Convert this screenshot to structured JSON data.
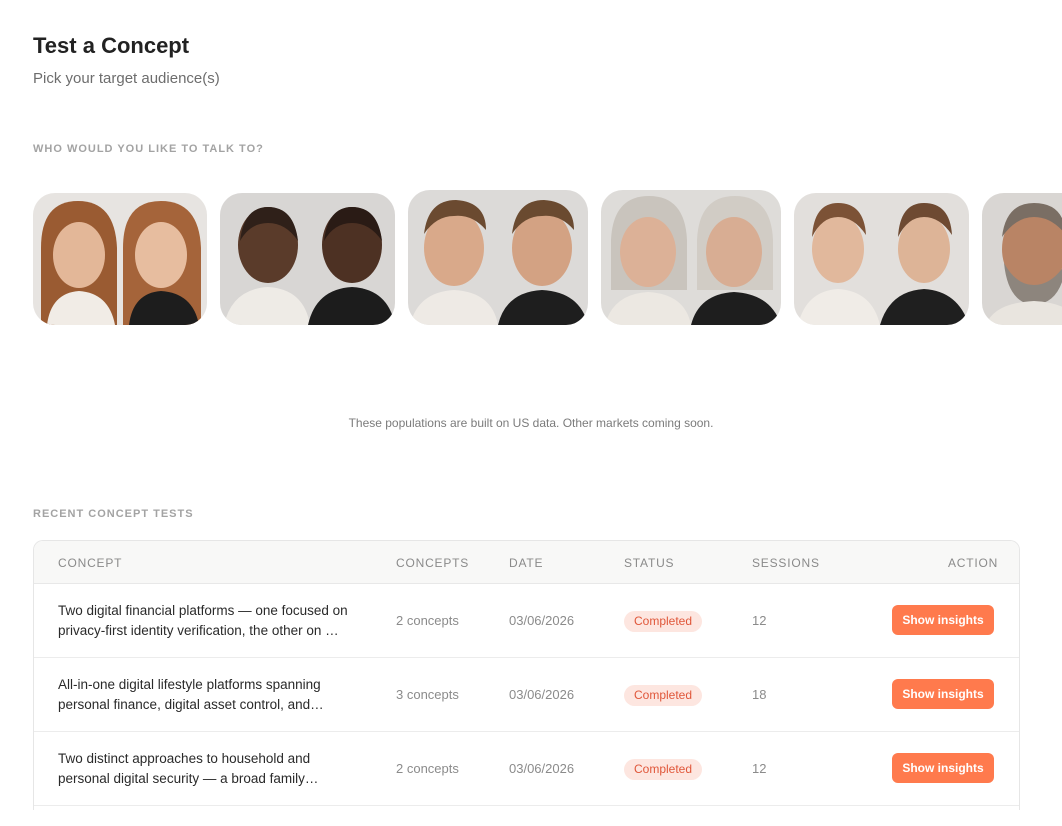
{
  "header": {
    "title": "Test a Concept",
    "subtitle": "Pick your target audience(s)"
  },
  "audience": {
    "section_label": "WHO WOULD YOU LIKE TO TALK TO?",
    "cards": [
      {
        "name": "young-women"
      },
      {
        "name": "older-black-men"
      },
      {
        "name": "young-men"
      },
      {
        "name": "older-women"
      },
      {
        "name": "young-androgynous"
      },
      {
        "name": "older-bearded-men"
      }
    ],
    "note": "These populations are built on US data. Other markets coming soon."
  },
  "recent": {
    "section_label": "RECENT CONCEPT TESTS",
    "columns": {
      "concept": "CONCEPT",
      "concepts": "CONCEPTS",
      "date": "DATE",
      "status": "STATUS",
      "sessions": "SESSIONS",
      "action": "ACTION"
    },
    "rows": [
      {
        "concept_line1": "Two digital financial platforms — one focused on",
        "concept_line2": "privacy-first identity verification, the other on …",
        "concepts": "2 concepts",
        "date": "03/06/2026",
        "status": "Completed",
        "sessions": "12",
        "action": "Show insights"
      },
      {
        "concept_line1": "All-in-one digital lifestyle platforms spanning",
        "concept_line2": "personal finance, digital asset control, and…",
        "concepts": "3 concepts",
        "date": "03/06/2026",
        "status": "Completed",
        "sessions": "18",
        "action": "Show insights"
      },
      {
        "concept_line1": "Two distinct approaches to household and",
        "concept_line2": "personal digital security — a broad family…",
        "concepts": "2 concepts",
        "date": "03/06/2026",
        "status": "Completed",
        "sessions": "12",
        "action": "Show insights"
      }
    ]
  }
}
